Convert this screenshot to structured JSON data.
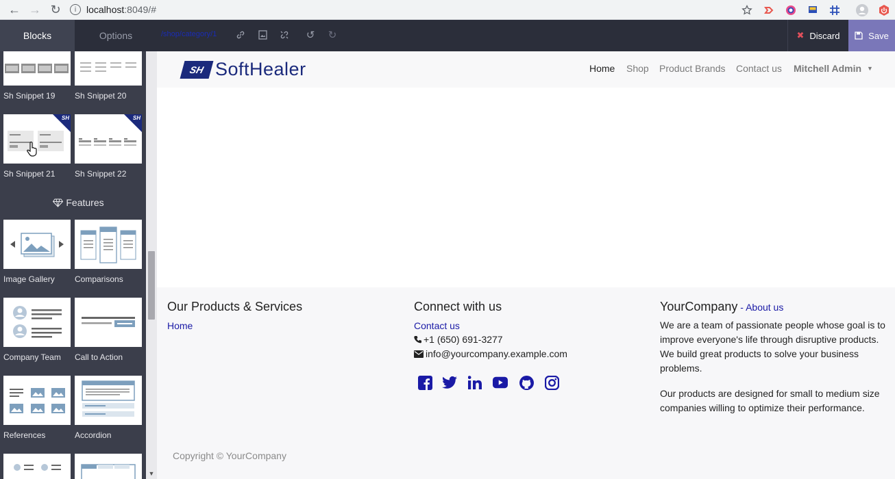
{
  "browser": {
    "url_host": "localhost",
    "url_rest": ":8049/#"
  },
  "editor": {
    "tab_blocks": "Blocks",
    "tab_options": "Options",
    "path": "/shop/category/1",
    "discard_label": "Discard",
    "save_label": "Save"
  },
  "sidebar": {
    "snippets": [
      {
        "label": "Sh Snippet 19"
      },
      {
        "label": "Sh Snippet 20"
      },
      {
        "label": "Sh Snippet 21"
      },
      {
        "label": "Sh Snippet 22"
      }
    ],
    "badge_text": "SH",
    "features_heading": "Features",
    "features": [
      {
        "label": "Image Gallery"
      },
      {
        "label": "Comparisons"
      },
      {
        "label": "Company Team"
      },
      {
        "label": "Call to Action"
      },
      {
        "label": "References"
      },
      {
        "label": "Accordion"
      }
    ]
  },
  "site": {
    "logo_mark": "SH",
    "logo_text": "SoftHealer",
    "nav": {
      "home": "Home",
      "shop": "Shop",
      "brands": "Product Brands",
      "contact": "Contact us",
      "user": "Mitchell Admin"
    },
    "footer": {
      "col1_title": "Our Products & Services",
      "col1_link": "Home",
      "col2_title": "Connect with us",
      "col2_link": "Contact us",
      "phone": "+1 (650) 691-3277",
      "email": "info@yourcompany.example.com",
      "col3_title": "YourCompany",
      "col3_sep": " - ",
      "col3_link": "About us",
      "about_p1": "We are a team of passionate people whose goal is to improve everyone's life through disruptive products. We build great products to solve your business problems.",
      "about_p2": "Our products are designed for small to medium size companies willing to optimize their performance.",
      "copyright": "Copyright © YourCompany"
    }
  },
  "colors": {
    "editor_bg": "#2b2e3a",
    "sidebar_bg": "#3b3e4b",
    "save_accent": "#7a77b9",
    "link": "#1a1aa6",
    "brand": "#1b2a7c"
  }
}
